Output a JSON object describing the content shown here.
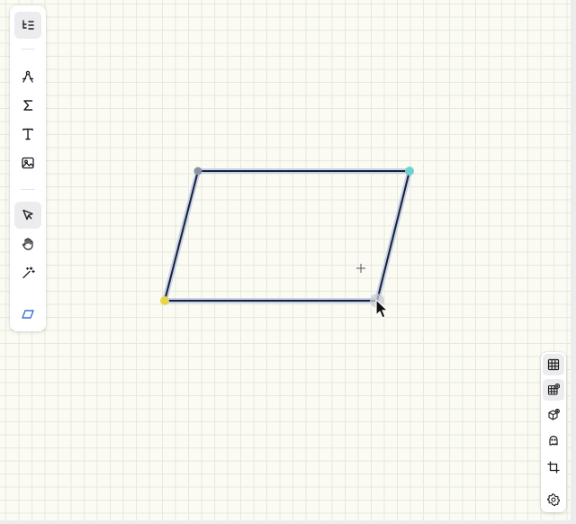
{
  "app": {
    "left_toolbar": [
      {
        "id": "outline",
        "icon": "list-outline-icon",
        "active": true
      },
      {
        "id": "geometry",
        "icon": "compass-icon",
        "active": false
      },
      {
        "id": "formula",
        "icon": "sigma-icon",
        "active": false
      },
      {
        "id": "text",
        "icon": "text-tool-icon",
        "active": false
      },
      {
        "id": "image",
        "icon": "image-icon",
        "active": false
      },
      {
        "id": "select",
        "icon": "pointer-icon",
        "active": true
      },
      {
        "id": "pan",
        "icon": "hand-icon",
        "active": false
      },
      {
        "id": "magic",
        "icon": "magic-wand-icon",
        "active": false
      },
      {
        "id": "parallelogram",
        "icon": "parallelogram-icon",
        "active": false
      }
    ],
    "right_panel": [
      {
        "id": "grid",
        "icon": "grid-icon",
        "active": true
      },
      {
        "id": "grid-snap",
        "icon": "grid-settings-icon",
        "active": true
      },
      {
        "id": "3d",
        "icon": "cube-icon",
        "active": false
      },
      {
        "id": "ghost",
        "icon": "ghost-icon",
        "active": false
      },
      {
        "id": "crop",
        "icon": "crop-icon",
        "active": false
      },
      {
        "id": "settings",
        "icon": "gear-icon",
        "active": false
      }
    ]
  },
  "colors": {
    "background": "#fbfbf4",
    "grid_line": "#e6e8dc",
    "shape_stroke": "#1a1f3c",
    "shape_halo": "#c7d3e6",
    "accent_blue": "#3b6fd8",
    "vertex_top_left": "#8a93a3",
    "vertex_top_right": "#6fd2cf",
    "vertex_bottom_left": "#e8d64a",
    "vertex_bottom_right": "#c9ccd6"
  },
  "shape": {
    "type": "parallelogram",
    "vertex_count": 4
  }
}
